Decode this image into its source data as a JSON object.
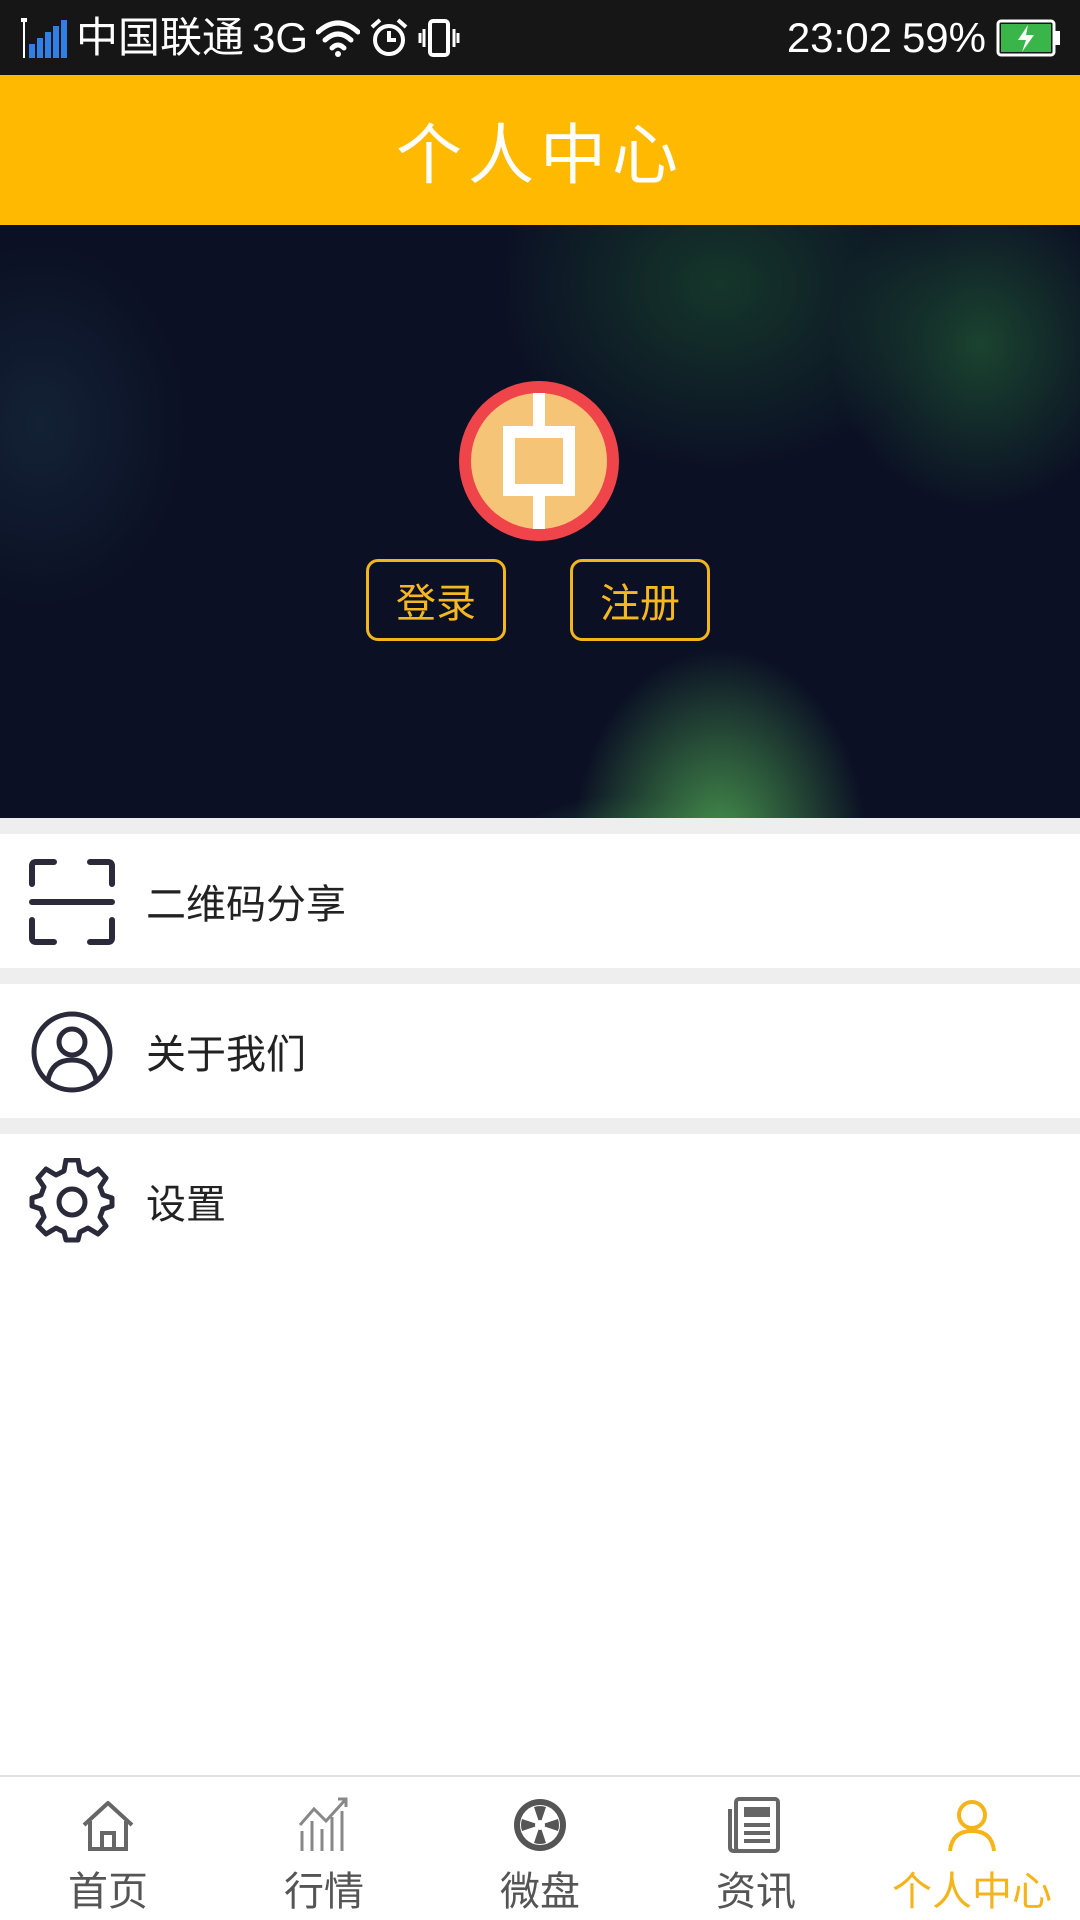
{
  "status_bar": {
    "carrier": "中国联通",
    "network": "3G",
    "time": "23:02",
    "battery": "59%",
    "icons": [
      "signal-icon",
      "wifi-icon",
      "alarm-icon",
      "vibrate-icon",
      "battery-charging-icon"
    ]
  },
  "header": {
    "title": "个人中心"
  },
  "hero": {
    "logo": "app-logo-icon",
    "login_label": "登录",
    "register_label": "注册"
  },
  "menu": {
    "items": [
      {
        "label": "二维码分享",
        "icon": "qr-scan-icon"
      },
      {
        "label": "关于我们",
        "icon": "user-circle-icon"
      },
      {
        "label": "设置",
        "icon": "gear-icon"
      }
    ]
  },
  "bottom_nav": {
    "items": [
      {
        "label": "首页",
        "icon": "home-icon"
      },
      {
        "label": "行情",
        "icon": "market-chart-icon"
      },
      {
        "label": "微盘",
        "icon": "wheel-icon"
      },
      {
        "label": "资讯",
        "icon": "news-icon"
      },
      {
        "label": "个人中心",
        "icon": "profile-icon",
        "active": true
      }
    ]
  },
  "colors": {
    "accent": "#FFBA00",
    "button_border": "#F2B51C",
    "active_nav": "#F5B41A",
    "status_bar_bg": "#161616",
    "logo_ring": "#F0444B",
    "logo_fill": "#F5C476"
  }
}
